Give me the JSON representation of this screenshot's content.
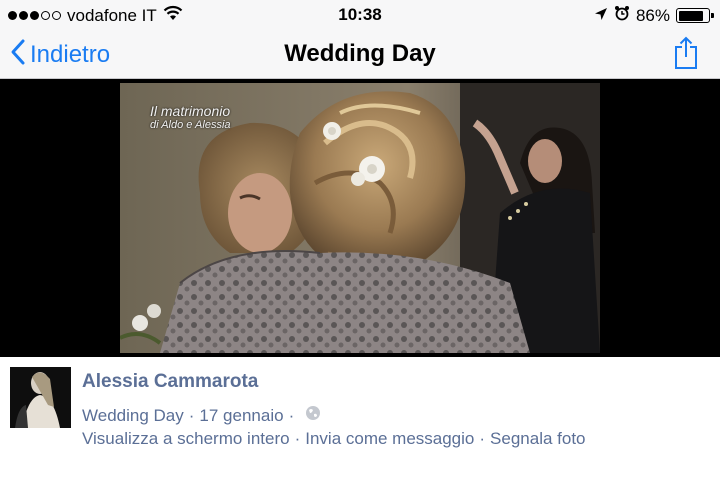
{
  "status_bar": {
    "signal_filled": 3,
    "signal_total": 5,
    "carrier": "vodafone IT",
    "time": "10:38",
    "battery_percent_label": "86%",
    "battery_level": 0.86,
    "icons": [
      "wifi-icon",
      "location-arrow-icon",
      "alarm-clock-icon",
      "battery-icon"
    ]
  },
  "nav": {
    "back_label": "Indietro",
    "title": "Wedding Day",
    "share_icon": "share-icon",
    "accent_color": "#1a7cf2"
  },
  "photo": {
    "watermark_line1": "Il matrimonio",
    "watermark_line2": "di Aldo e Alessia"
  },
  "post": {
    "author": "Alessia Cammarota",
    "album": "Wedding Day",
    "date": "17 gennaio",
    "privacy_icon": "globe-icon",
    "actions": [
      "Visualizza a schermo intero",
      "Invia come messaggio",
      "Segnala foto"
    ],
    "link_color": "#5b6f96"
  }
}
